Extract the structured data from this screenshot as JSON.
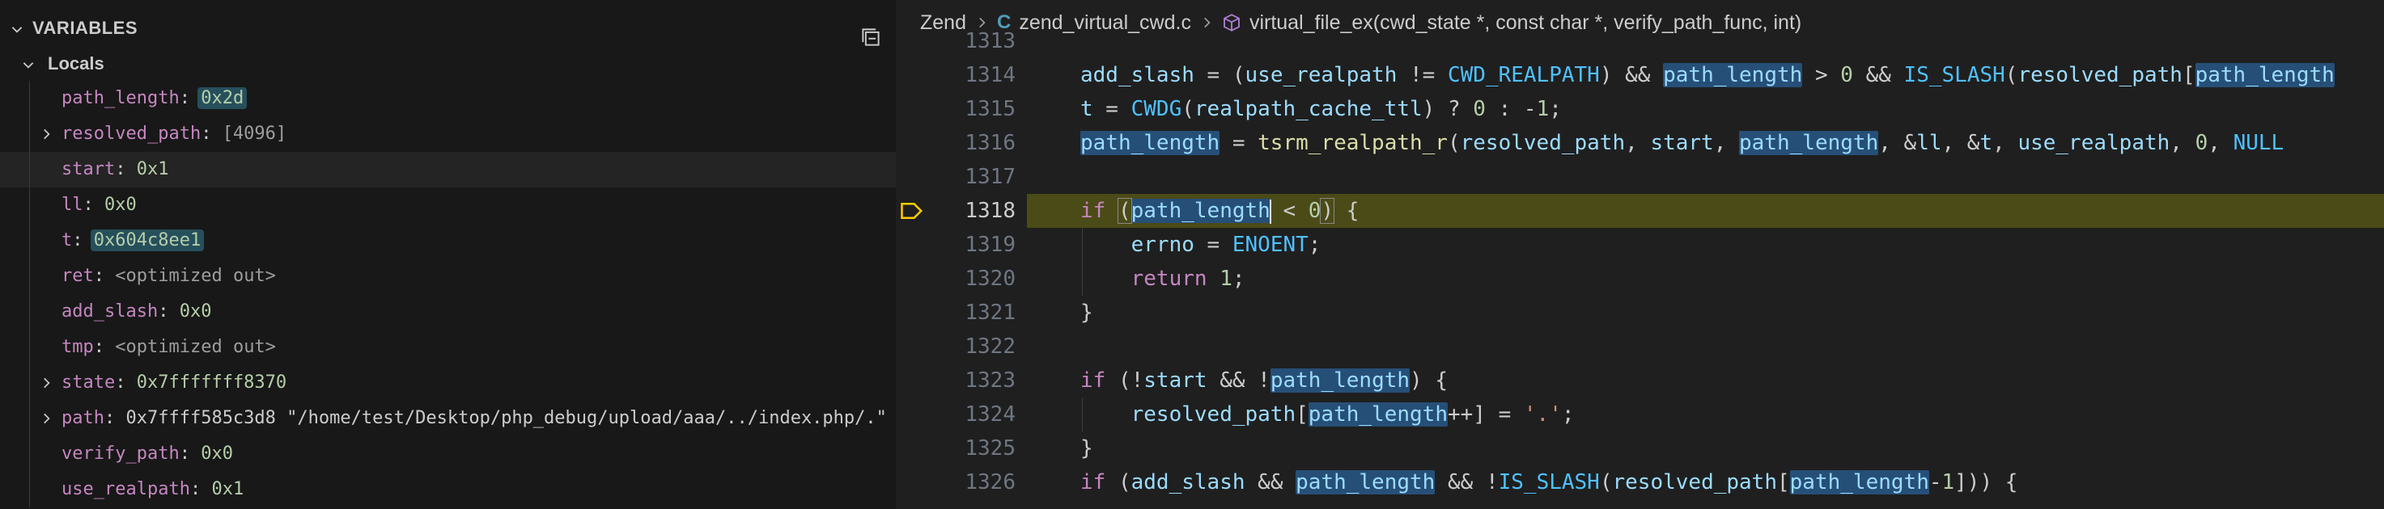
{
  "variables_panel": {
    "section_title": "VARIABLES",
    "scope_label": "Locals",
    "variables": [
      {
        "name": "path_length",
        "value": "0x2d",
        "expandable": false,
        "changed": true,
        "kind": "num"
      },
      {
        "name": "resolved_path",
        "value": "[4096]",
        "expandable": true,
        "changed": false,
        "kind": "dim"
      },
      {
        "name": "start",
        "value": "0x1",
        "expandable": false,
        "changed": false,
        "kind": "num"
      },
      {
        "name": "ll",
        "value": "0x0",
        "expandable": false,
        "changed": false,
        "kind": "num"
      },
      {
        "name": "t",
        "value": "0x604c8ee1",
        "expandable": false,
        "changed": true,
        "kind": "num"
      },
      {
        "name": "ret",
        "value": "<optimized out>",
        "expandable": false,
        "changed": false,
        "kind": "dim"
      },
      {
        "name": "add_slash",
        "value": "0x0",
        "expandable": false,
        "changed": false,
        "kind": "num"
      },
      {
        "name": "tmp",
        "value": "<optimized out>",
        "expandable": false,
        "changed": false,
        "kind": "dim"
      },
      {
        "name": "state",
        "value": "0x7fffffff8370",
        "expandable": true,
        "changed": false,
        "kind": "num"
      },
      {
        "name": "path",
        "value": "0x7ffff585c3d8",
        "value_string": "\"/home/test/Desktop/php_debug/upload/aaa/../index.php/.\"",
        "expandable": true,
        "changed": false,
        "kind": "addr"
      },
      {
        "name": "verify_path",
        "value": "0x0",
        "expandable": false,
        "changed": false,
        "kind": "num"
      },
      {
        "name": "use_realpath",
        "value": "0x1",
        "expandable": false,
        "changed": false,
        "kind": "num"
      }
    ]
  },
  "breadcrumb": {
    "folder": "Zend",
    "file_icon": "C",
    "file": "zend_virtual_cwd.c",
    "symbol": "virtual_file_ex(cwd_state *, const char *, verify_path_func, int)"
  },
  "editor": {
    "current_line": "1318",
    "lines": [
      {
        "num": "1313"
      },
      {
        "num": "1314"
      },
      {
        "num": "1315"
      },
      {
        "num": "1316"
      },
      {
        "num": "1317"
      },
      {
        "num": "1318"
      },
      {
        "num": "1319"
      },
      {
        "num": "1320"
      },
      {
        "num": "1321"
      },
      {
        "num": "1322"
      },
      {
        "num": "1323"
      },
      {
        "num": "1324"
      },
      {
        "num": "1325"
      },
      {
        "num": "1326"
      }
    ]
  },
  "colors": {
    "panel_bg": "#181818",
    "editor_bg": "#1f1f1f",
    "stopped_line": "#4b4b18",
    "keyword": "#c586c0",
    "function": "#dcdcaa",
    "macro": "#4fc1ff",
    "number": "#b5cea8",
    "string": "#ce9178",
    "variable": "#9cdcfe"
  },
  "icons": {
    "collapse_all": "collapse-all-icon",
    "breakpoint_arrow": "debug-stackframe-icon",
    "symbol": "method-cube-icon"
  }
}
